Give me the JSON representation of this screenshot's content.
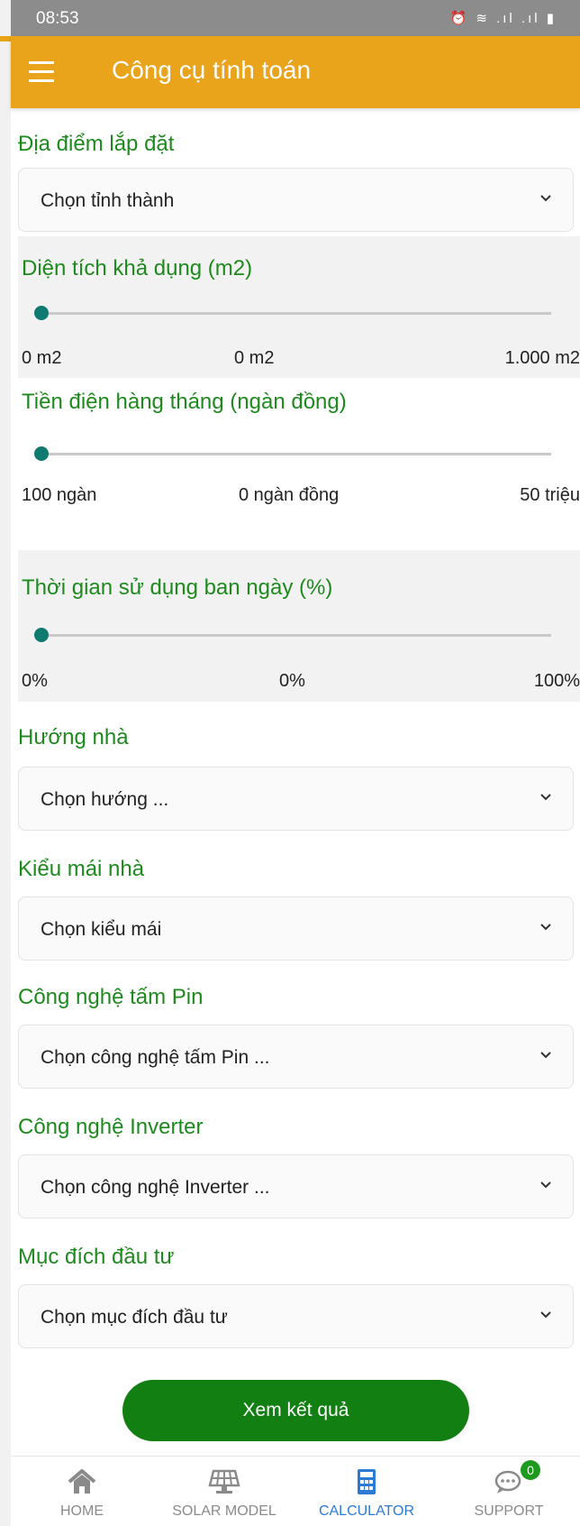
{
  "status_bar": {
    "time": "08:53",
    "icons": "⏰ ≋ .ıl .ıl ▮"
  },
  "app_bar": {
    "title": "Công cụ tính toán"
  },
  "location": {
    "label": "Địa điểm lắp đặt",
    "value": "Chọn tỉnh thành"
  },
  "area_slider": {
    "label": "Diện tích khả dụng (m2)",
    "min": "0 m2",
    "current": "0 m2",
    "max": "1.000 m2",
    "level": 0
  },
  "bill_slider": {
    "label": "Tiền điện hàng tháng (ngàn đồng)",
    "min": "100 ngàn",
    "current": "0 ngàn đồng",
    "max": "50 triệu",
    "level": 0
  },
  "daytime_slider": {
    "label": "Thời gian sử dụng ban ngày (%)",
    "min": "0%",
    "current": "0%",
    "max": "100%",
    "level": 0
  },
  "house_direction": {
    "label": "Hướng nhà",
    "value": "Chọn hướng ..."
  },
  "roof_type": {
    "label": "Kiểu mái nhà",
    "value": "Chọn kiểu mái"
  },
  "panel_tech": {
    "label": "Công nghệ tấm Pin",
    "value": "Chọn công nghệ tấm Pin ..."
  },
  "inverter_tech": {
    "label": "Công nghệ Inverter",
    "value": "Chọn công nghệ Inverter ..."
  },
  "investment_purpose": {
    "label": "Mục đích đầu tư",
    "value": "Chọn mục đích đầu tư"
  },
  "submit": {
    "label": "Xem kết quả"
  },
  "bottom_nav": {
    "home": "HOME",
    "solar_model": "SOLAR MODEL",
    "calculator": "CALCULATOR",
    "support": "SUPPORT",
    "support_badge": "0"
  },
  "colors": {
    "app_bar": "#e9a41b",
    "label_green": "#1e8a1e",
    "button_green": "#117f11",
    "slider_thumb": "#0f7a6f",
    "nav_active": "#2b7bd6"
  }
}
